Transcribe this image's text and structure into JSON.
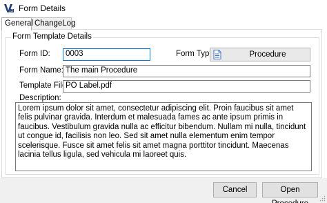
{
  "window": {
    "title": "Form Details"
  },
  "tabs": [
    {
      "label": "General",
      "active": true
    },
    {
      "label": "ChangeLog",
      "active": false
    }
  ],
  "group": {
    "title": "Form Template Details"
  },
  "fields": {
    "form_id": {
      "label": "Form ID:",
      "value": "0003"
    },
    "form_type": {
      "label": "Form Type:",
      "value": "Procedure",
      "icon": "document-icon"
    },
    "form_name": {
      "label": "Form Name:",
      "value": "The main Procedure"
    },
    "template_file": {
      "label": "Template File:",
      "value": "PO Label.pdf"
    },
    "description": {
      "label": "Description:",
      "value": "Lorem ipsum dolor sit amet, consectetur adipiscing elit. Proin faucibus sit amet felis pulvinar gravida. Interdum et malesuada fames ac ante ipsum primis in faucibus. Vestibulum gravida nulla ac efficitur bibendum. Nullam mi nulla, tincidunt ut congue id, facilisis non leo. Sed sit amet nulla elementum enim tempor scelerisque. Fusce sit amet felis sit amet magna porttitor tincidunt. Maecenas lacinia tellus ligula, sed vehicula mi laoreet quis."
    }
  },
  "buttons": {
    "cancel": "Cancel",
    "open": "Open Procedure"
  },
  "colors": {
    "focus_border": "#0078d7",
    "footer_bg": "#f0f0f0",
    "app_icon": "#1f3b73"
  }
}
